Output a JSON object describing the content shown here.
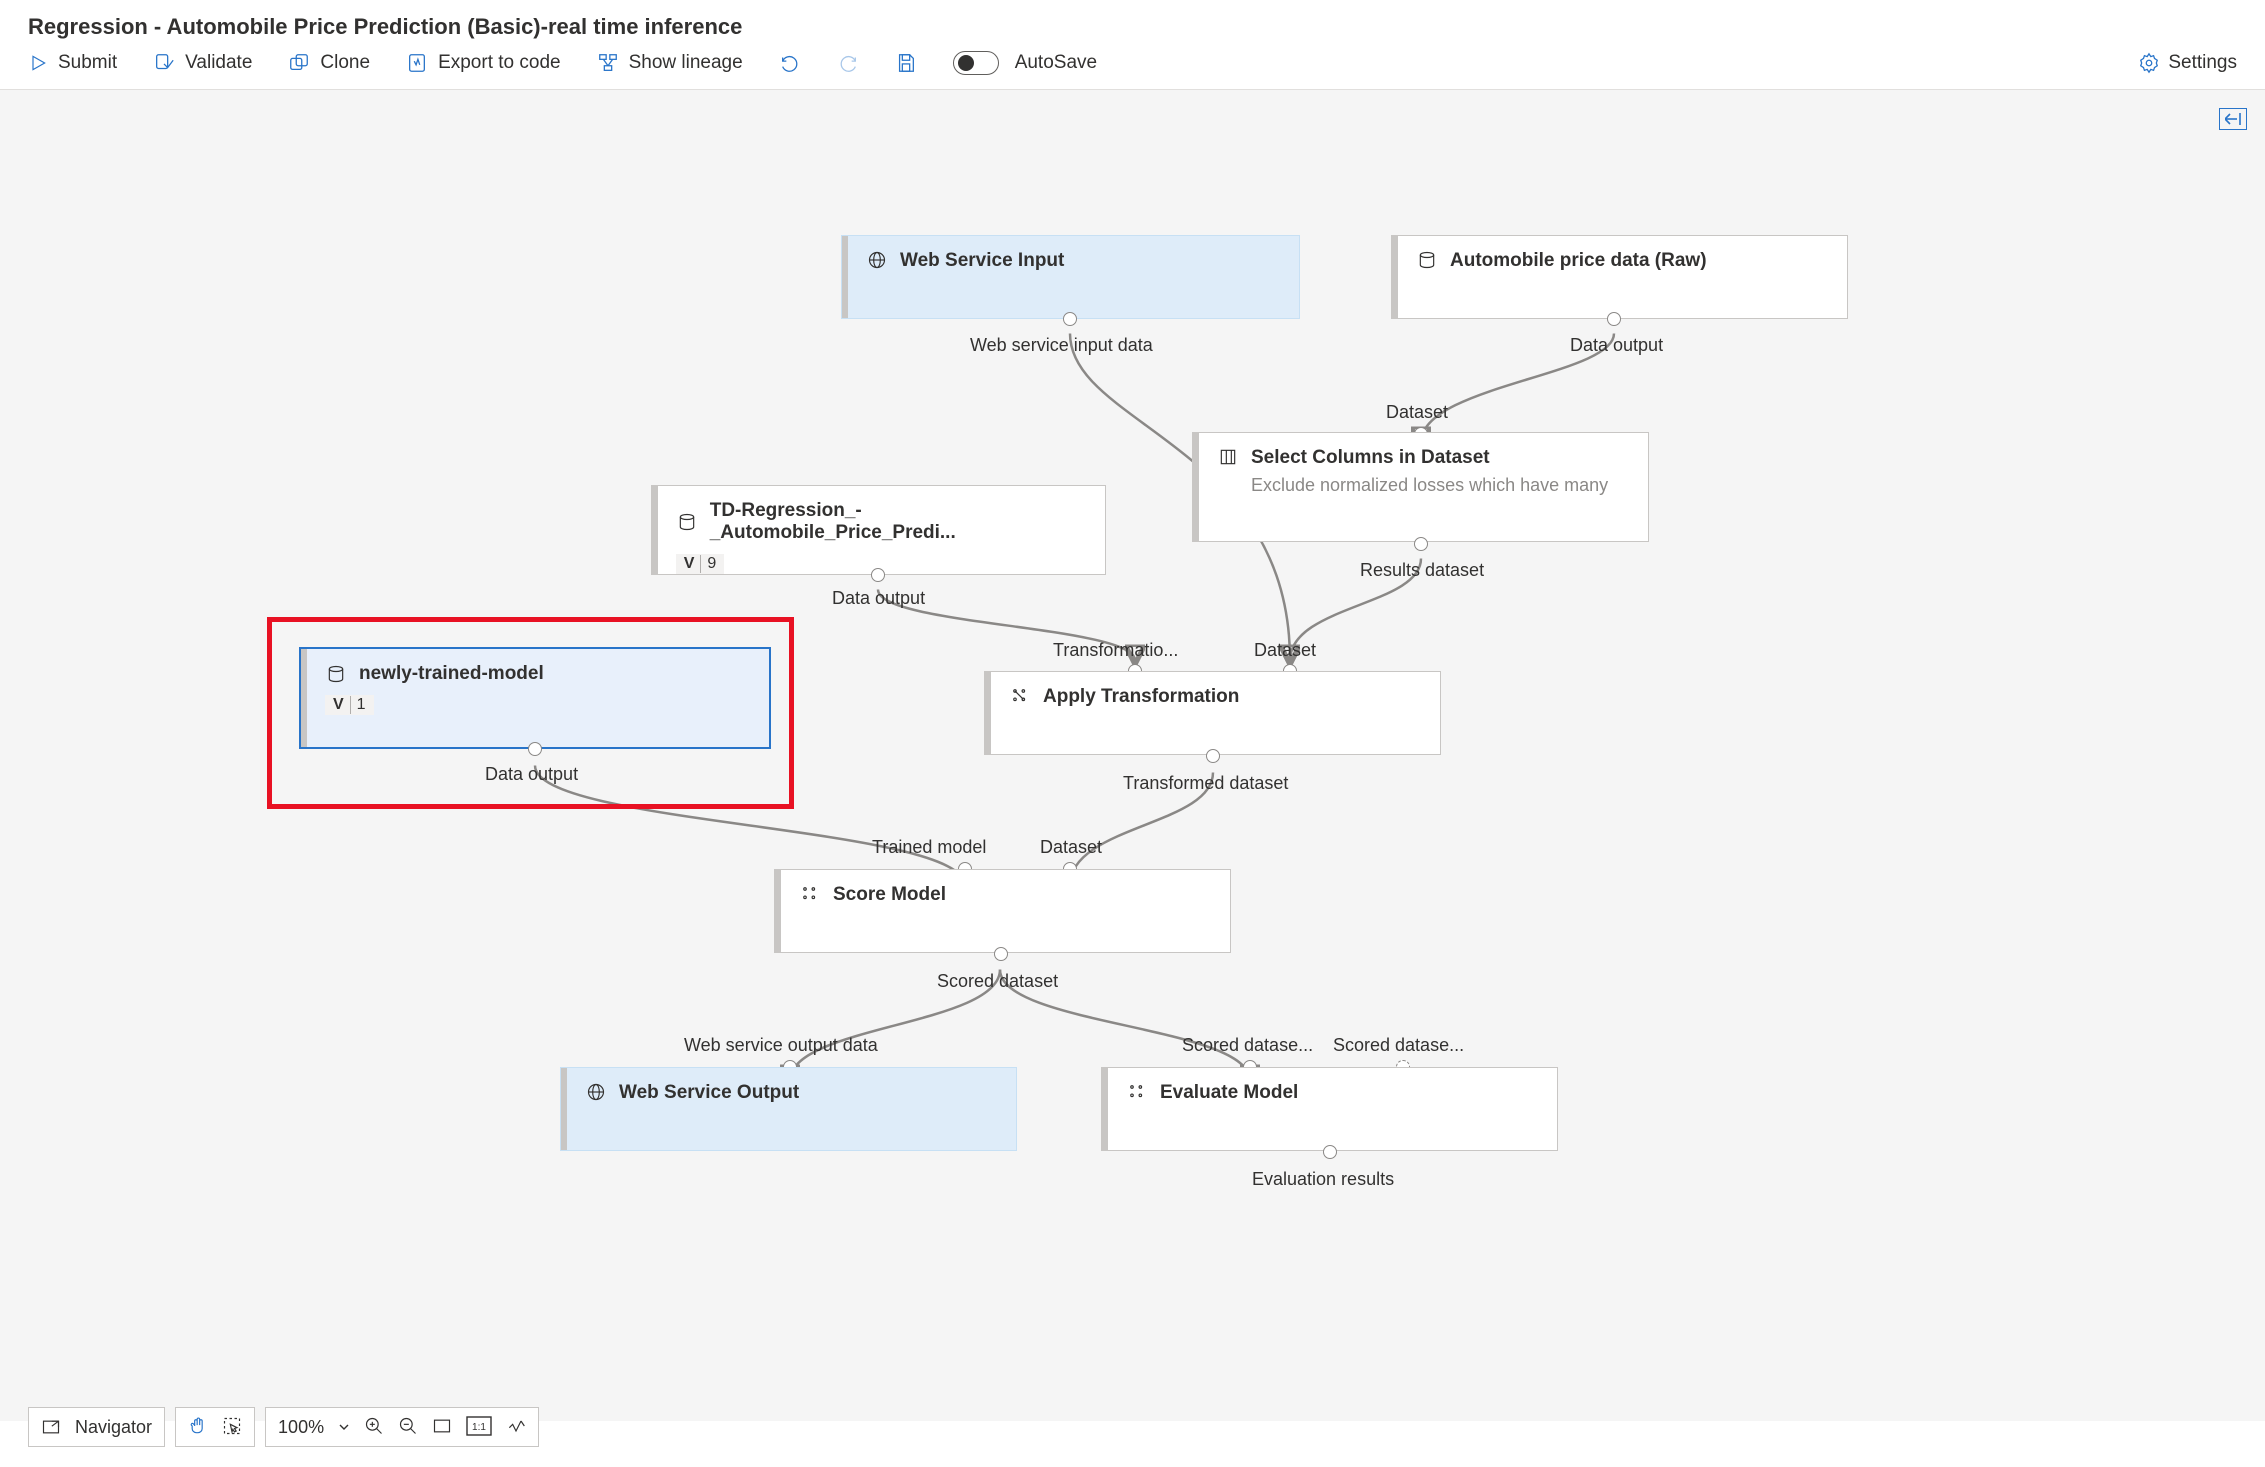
{
  "title": "Regression - Automobile Price Prediction (Basic)-real time inference",
  "toolbar": {
    "submit": "Submit",
    "validate": "Validate",
    "clone": "Clone",
    "export": "Export to code",
    "lineage": "Show lineage",
    "autosave": "AutoSave",
    "settings": "Settings"
  },
  "nodes": {
    "web_service_input": {
      "label": "Web Service Input"
    },
    "auto_price_raw": {
      "label": "Automobile price data (Raw)"
    },
    "select_columns": {
      "label": "Select Columns in Dataset",
      "subtitle": "Exclude normalized losses which have many"
    },
    "td_regression": {
      "label": "TD-Regression_-_Automobile_Price_Predi...",
      "version": "9"
    },
    "new_model": {
      "label": "newly-trained-model",
      "version": "1"
    },
    "apply_transformation": {
      "label": "Apply Transformation"
    },
    "score_model": {
      "label": "Score Model"
    },
    "web_service_output": {
      "label": "Web Service Output"
    },
    "evaluate_model": {
      "label": "Evaluate Model"
    }
  },
  "port_labels": {
    "wsi_out": "Web service input data",
    "auto_out": "Data output",
    "dataset": "Dataset",
    "results_dataset": "Results dataset",
    "transformation": "Transformatio...",
    "td_out": "Data output",
    "new_model_out": "Data output",
    "transformed_dataset": "Transformed dataset",
    "trained_model": "Trained model",
    "scored_dataset": "Scored dataset",
    "wso_in": "Web service output data",
    "scored_in": "Scored datase...",
    "scored_in2": "Scored datase...",
    "evaluation_results": "Evaluation results"
  },
  "footer": {
    "navigator": "Navigator",
    "zoom": "100%"
  }
}
